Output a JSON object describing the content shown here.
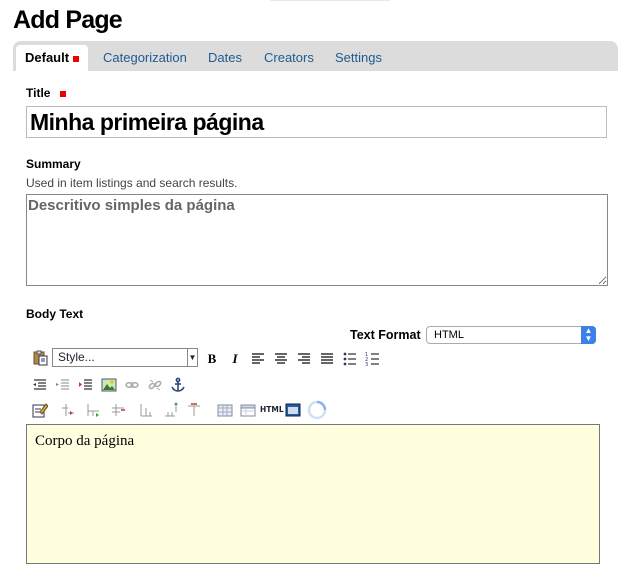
{
  "page": {
    "title": "Add Page"
  },
  "tabs": [
    {
      "label": "Default",
      "active": true
    },
    {
      "label": "Categorization"
    },
    {
      "label": "Dates"
    },
    {
      "label": "Creators"
    },
    {
      "label": "Settings"
    }
  ],
  "fields": {
    "title": {
      "label": "Title",
      "value": "Minha primeira página",
      "required": true
    },
    "summary": {
      "label": "Summary",
      "help": "Used in item listings and search results.",
      "value": "Descritivo simples da página"
    },
    "body": {
      "label": "Body Text",
      "value": "Corpo da página"
    },
    "text_format": {
      "label": "Text Format",
      "value": "HTML"
    }
  },
  "editor": {
    "style_select": "Style...",
    "html_button": "HTML",
    "toolbar_row1": [
      "paste-icon",
      "bold-icon",
      "italic-icon",
      "align-left-icon",
      "align-center-icon",
      "align-right-icon",
      "justify-icon",
      "bullet-list-icon",
      "numbered-list-icon"
    ],
    "toolbar_row2": [
      "outdent-icon",
      "indent-icon",
      "blockquote-icon",
      "image-icon",
      "link-icon",
      "unlink-icon",
      "anchor-icon"
    ],
    "toolbar_row3": [
      "edit-icon",
      "table-insert-row-icon",
      "table-row-after-icon",
      "table-delete-row-icon",
      "table-insert-col-icon",
      "table-col-after-icon",
      "table-delete-col-icon",
      "table-icon",
      "table-props-icon",
      "html-source-icon",
      "fullscreen-icon",
      "spinner-icon"
    ]
  },
  "colors": {
    "tab_link": "#205c90",
    "required": "#e00000",
    "body_bg": "#ffffe0",
    "select_accent": "#3b82e8"
  }
}
